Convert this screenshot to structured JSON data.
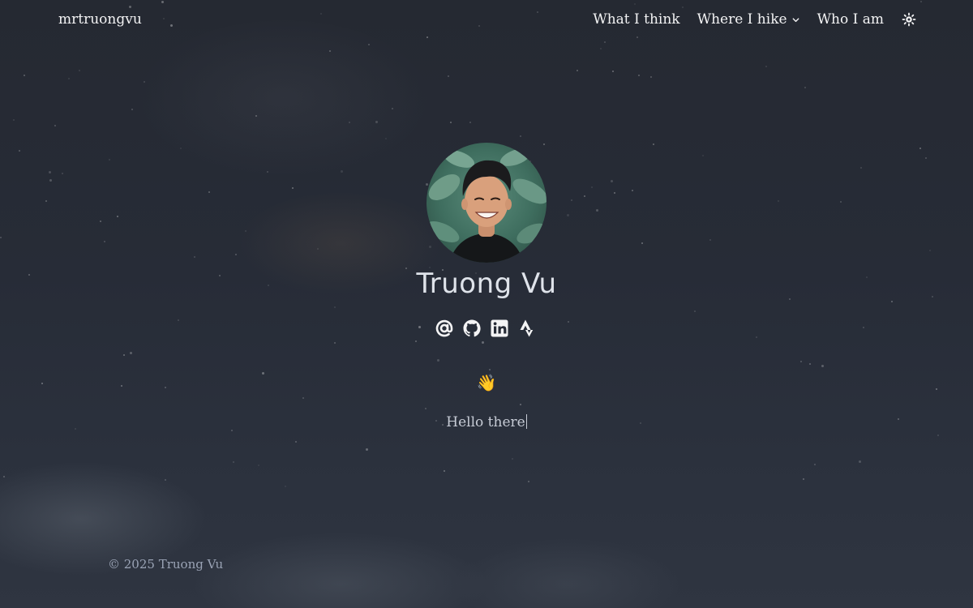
{
  "site": {
    "brand": "mrtruongvu"
  },
  "nav": {
    "items": [
      {
        "label": "What I think",
        "has_dropdown": false
      },
      {
        "label": "Where I hike",
        "has_dropdown": true
      },
      {
        "label": "Who I am",
        "has_dropdown": false
      }
    ],
    "theme_toggle_icon": "sun-icon"
  },
  "profile": {
    "name": "Truong Vu",
    "avatar_icon": "profile-photo",
    "socials": [
      {
        "icon": "at-email-icon"
      },
      {
        "icon": "github-icon"
      },
      {
        "icon": "linkedin-icon"
      },
      {
        "icon": "strava-icon"
      }
    ],
    "emoji": "👋",
    "greeting": "Hello there"
  },
  "footer": {
    "copyright": "© 2025 Truong Vu"
  },
  "colors": {
    "background": "#262b36",
    "text": "#f3f4f6",
    "muted": "#9aa3b5"
  }
}
